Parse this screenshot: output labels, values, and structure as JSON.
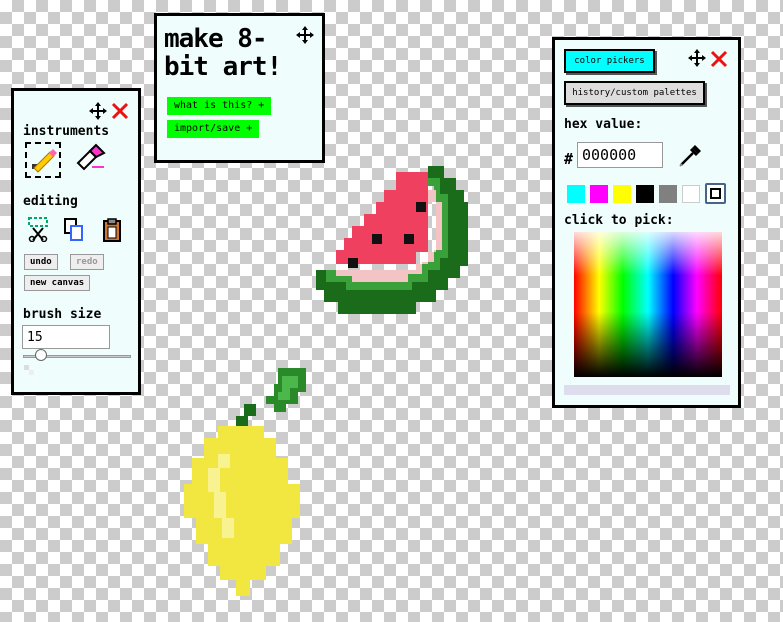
{
  "title_panel": {
    "title": "make 8-bit art!",
    "what_label": "what is this? +",
    "import_label": "import/save +"
  },
  "tools_panel": {
    "instruments_heading": "instruments",
    "editing_heading": "editing",
    "undo_label": "undo",
    "redo_label": "redo",
    "new_canvas_label": "new canvas",
    "brush_size_heading": "brush size",
    "brush_size_value": "15",
    "brush_slider_value": 15
  },
  "color_panel": {
    "color_pickers_tab": "color pickers",
    "history_tab": "history/custom palettes",
    "hex_heading": "hex value:",
    "hash_symbol": "#",
    "hex_value": "000000",
    "click_to_pick": "click to pick:",
    "swatches": [
      "#00ffff",
      "#ff00ff",
      "#ffff00",
      "#000000",
      "#808080",
      "#ffffff"
    ],
    "selected_swatch": "#000000"
  },
  "icons": [
    "move-icon",
    "close-icon",
    "pencil-icon",
    "eraser-icon",
    "select-icon",
    "copy-icon",
    "paste-icon",
    "eyedropper-icon",
    "palette-icon"
  ]
}
